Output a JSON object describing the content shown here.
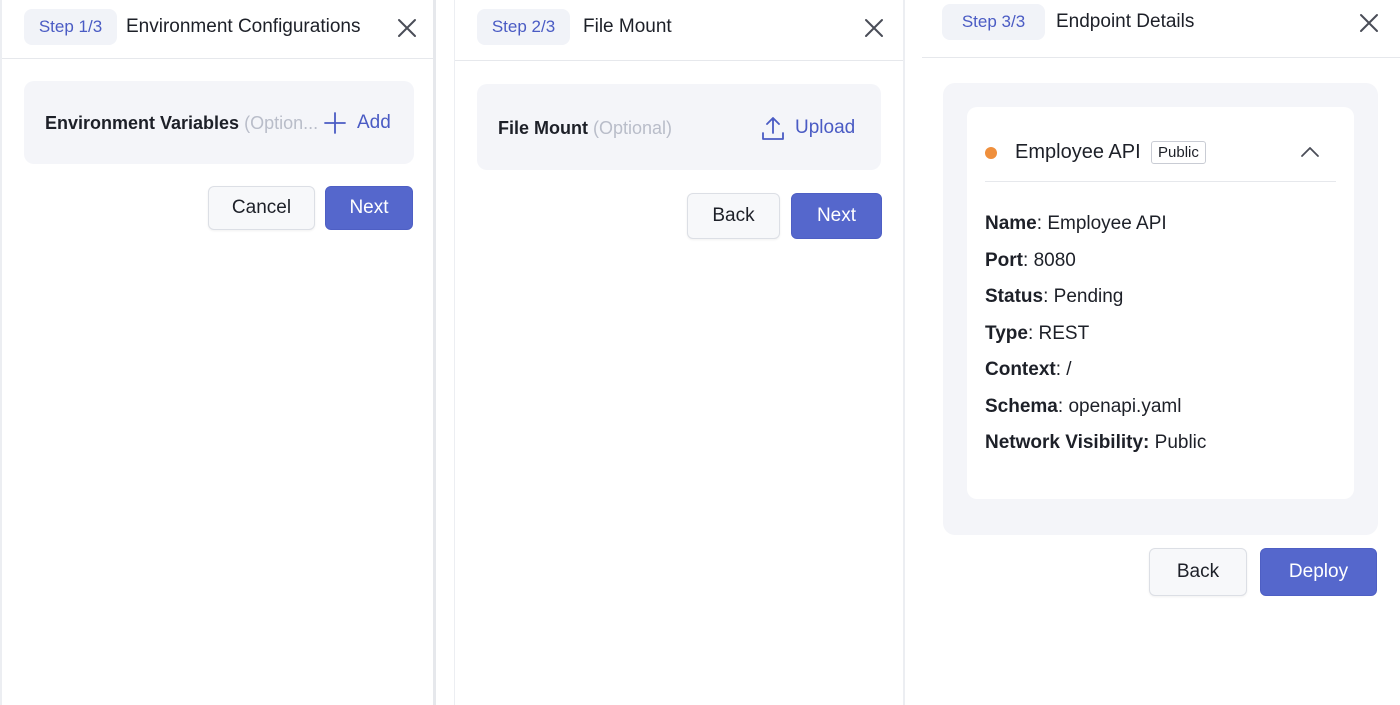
{
  "panels": [
    {
      "step": "Step 1/3",
      "title": "Environment Configurations",
      "field": {
        "label": "Environment Variables",
        "optional": "(Option...",
        "action": "Add",
        "action_icon": "plus-icon"
      },
      "buttons": {
        "secondary": "Cancel",
        "primary": "Next"
      }
    },
    {
      "step": "Step 2/3",
      "title": "File Mount",
      "field": {
        "label": "File Mount",
        "optional": "(Optional)",
        "action": "Upload",
        "action_icon": "upload-icon"
      },
      "buttons": {
        "secondary": "Back",
        "primary": "Next"
      }
    },
    {
      "step": "Step 3/3",
      "title": "Endpoint Details",
      "endpoint": {
        "name": "Employee API",
        "badge": "Public",
        "status_dot_color": "#ef8f3c",
        "details": [
          {
            "key": "Name",
            "sep": ": ",
            "value": "Employee API"
          },
          {
            "key": "Port",
            "sep": ": ",
            "value": "8080"
          },
          {
            "key": "Status",
            "sep": ": ",
            "value": "Pending"
          },
          {
            "key": "Type",
            "sep": ": ",
            "value": "REST"
          },
          {
            "key": "Context",
            "sep": ": ",
            "value": "/"
          },
          {
            "key": "Schema",
            "sep": ": ",
            "value": "openapi.yaml"
          },
          {
            "key": "Network Visibility:",
            "sep": " ",
            "value": "Public"
          }
        ]
      },
      "buttons": {
        "secondary": "Back",
        "primary": "Deploy"
      }
    }
  ],
  "colors": {
    "accent": "#5567cc",
    "step_text": "#4a5bc4",
    "chip_bg": "#f1f3f8",
    "field_bg": "#f4f5f9"
  }
}
